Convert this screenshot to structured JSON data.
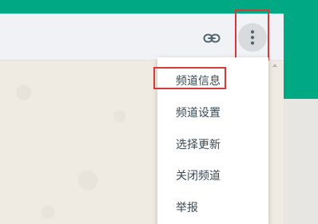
{
  "colors": {
    "brand_green": "#00a884",
    "header_bg": "#f0f2f5",
    "icon_gray": "#54656f",
    "highlight_red": "#d33a3a"
  },
  "header": {
    "link_icon": "link-icon",
    "menu_icon": "vertical-dots-icon"
  },
  "menu": {
    "items": [
      {
        "label": "频道信息"
      },
      {
        "label": "频道设置"
      },
      {
        "label": "选择更新"
      },
      {
        "label": "关闭频道"
      },
      {
        "label": "举报"
      }
    ]
  }
}
